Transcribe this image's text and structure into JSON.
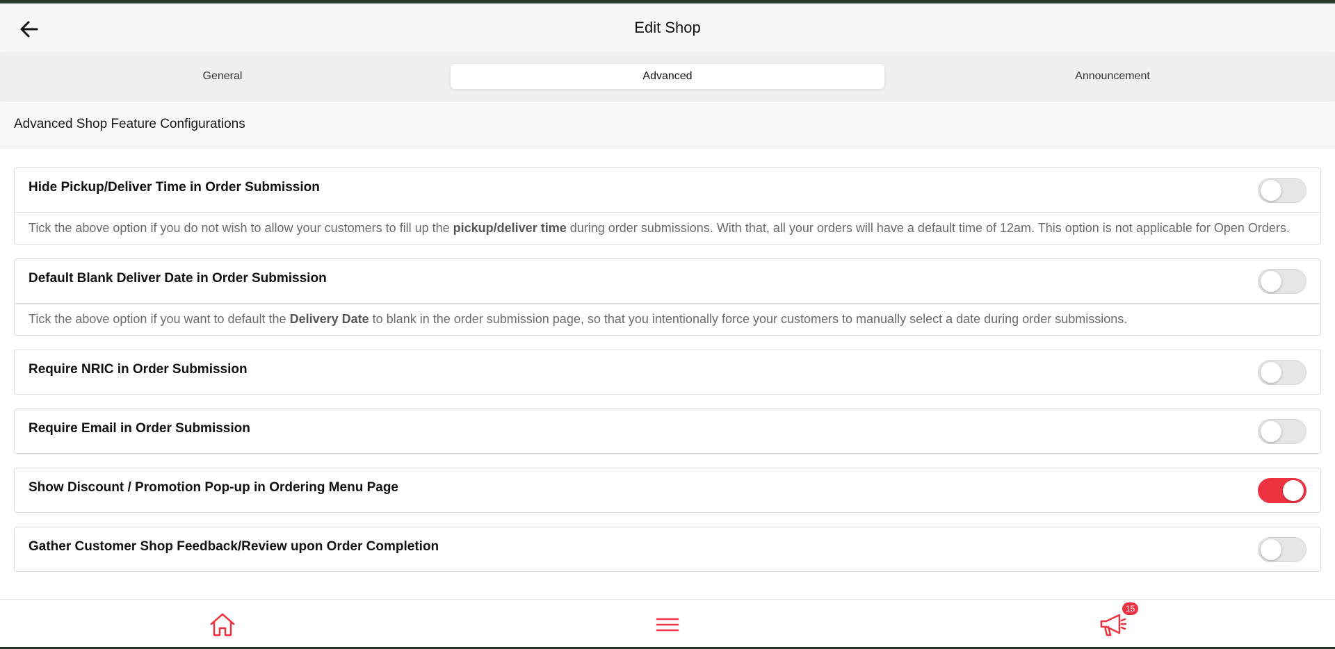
{
  "header": {
    "title": "Edit Shop",
    "back_icon": "arrow-left-icon"
  },
  "tabs": [
    {
      "label": "General",
      "active": false
    },
    {
      "label": "Advanced",
      "active": true
    },
    {
      "label": "Announcement",
      "active": false
    }
  ],
  "section": {
    "title": "Advanced Shop Feature Configurations"
  },
  "settings": [
    {
      "title": "Hide Pickup/Deliver Time in Order Submission",
      "enabled": false,
      "desc_before": "Tick the above option if you do not wish to allow your customers to fill up the ",
      "desc_bold": "pickup/deliver time",
      "desc_after": " during order submissions. With that, all your orders will have a default time of 12am. This option is not applicable for Open Orders."
    },
    {
      "title": "Default Blank Deliver Date in Order Submission",
      "enabled": false,
      "desc_before": "Tick the above option if you want to default the ",
      "desc_bold": "Delivery Date",
      "desc_after": " to blank in the order submission page, so that you intentionally force your customers to manually select a date during order submissions."
    },
    {
      "title": "Require NRIC in Order Submission",
      "enabled": false
    },
    {
      "title": "Require Email in Order Submission",
      "enabled": false
    },
    {
      "title": "Show Discount / Promotion Pop-up in Ordering Menu Page",
      "enabled": true
    },
    {
      "title": "Gather Customer Shop Feedback/Review upon Order Completion",
      "enabled": false
    }
  ],
  "bottom_nav": {
    "home_icon": "home-icon",
    "menu_icon": "hamburger-menu-icon",
    "announce_icon": "megaphone-icon",
    "announce_badge": "15"
  },
  "colors": {
    "accent": "#ee3340",
    "toggle_off": "#e6e6e6"
  }
}
